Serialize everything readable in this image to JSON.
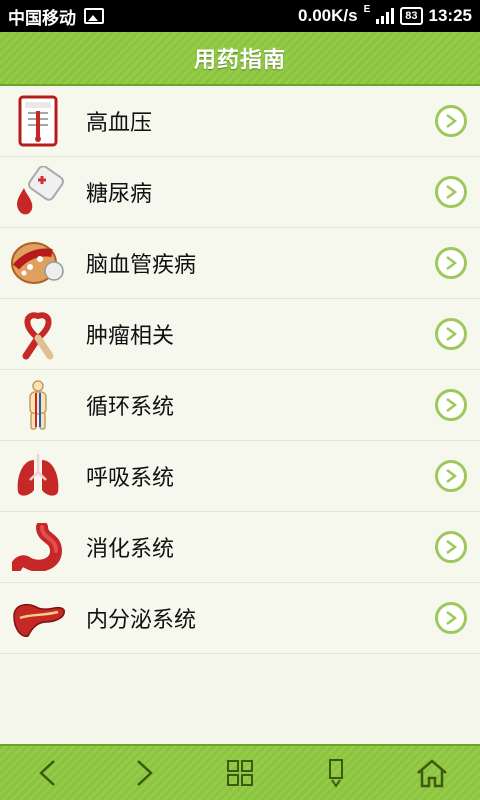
{
  "status_bar": {
    "carrier": "中国移动",
    "speed": "0.00K/s",
    "network": "E",
    "battery": "83",
    "time": "13:25"
  },
  "header": {
    "title": "用药指南"
  },
  "menu": [
    {
      "label": "高血压",
      "icon": "blood-pressure-chart-icon"
    },
    {
      "label": "糖尿病",
      "icon": "blood-drop-bag-icon"
    },
    {
      "label": "脑血管疾病",
      "icon": "blood-vessel-icon"
    },
    {
      "label": "肿瘤相关",
      "icon": "awareness-ribbon-icon"
    },
    {
      "label": "循环系统",
      "icon": "human-body-icon"
    },
    {
      "label": "呼吸系统",
      "icon": "lungs-icon"
    },
    {
      "label": "消化系统",
      "icon": "stomach-icon"
    },
    {
      "label": "内分泌系统",
      "icon": "pancreas-icon"
    }
  ],
  "bottom_nav": [
    {
      "name": "back",
      "icon": "chevron-left-icon"
    },
    {
      "name": "forward",
      "icon": "chevron-right-icon"
    },
    {
      "name": "grid",
      "icon": "grid-icon"
    },
    {
      "name": "menu",
      "icon": "phone-menu-icon"
    },
    {
      "name": "home",
      "icon": "home-icon"
    }
  ],
  "colors": {
    "accent_green": "#8bc43e",
    "arrow_ring": "#9ec95a",
    "background": "#f4f7ea"
  }
}
